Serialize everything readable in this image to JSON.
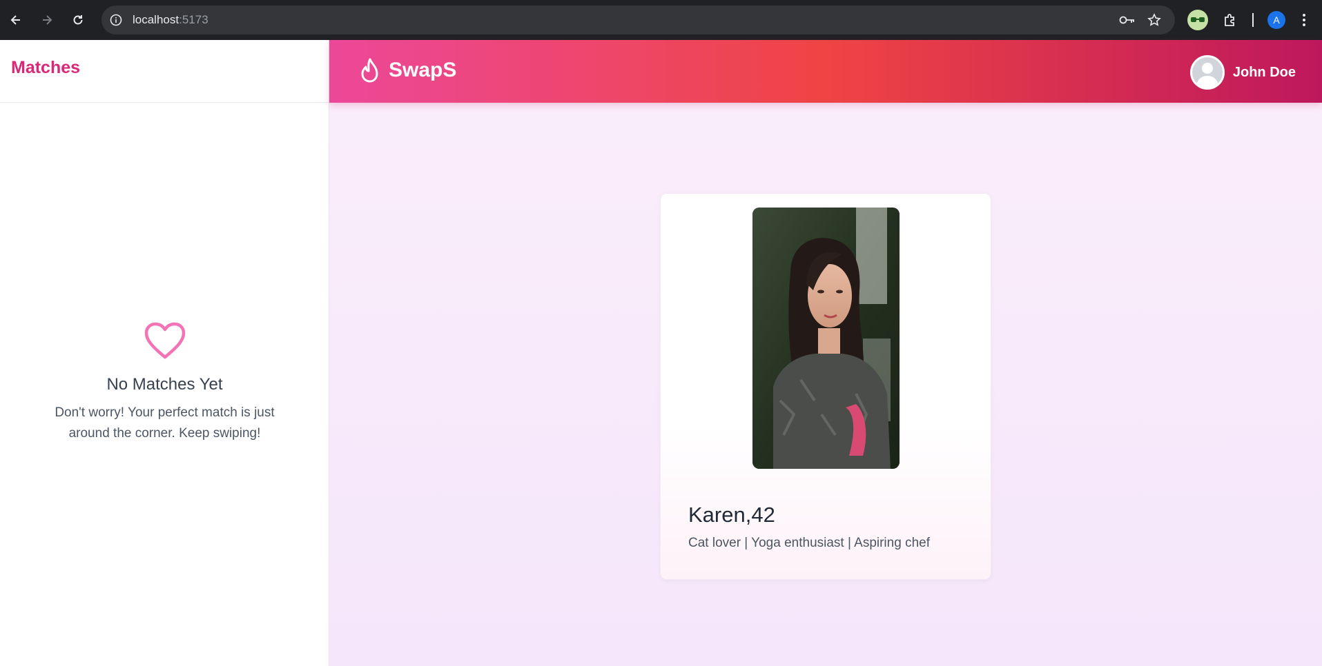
{
  "browser": {
    "url_host": "localhost",
    "url_port": ":5173",
    "profile_initial": "A"
  },
  "sidebar": {
    "title": "Matches",
    "empty_state": {
      "icon": "heart-icon",
      "heading": "No Matches Yet",
      "message": "Don't worry! Your perfect match is just around the corner. Keep swiping!"
    }
  },
  "header": {
    "brand": "SwapS",
    "brand_icon": "flame-icon",
    "user_name": "John Doe"
  },
  "card": {
    "name_age": "Karen,42",
    "bio": "Cat lover | Yoga enthusiast | Aspiring chef"
  },
  "colors": {
    "brand_pink": "#db2777",
    "gradient_start": "#ec4899",
    "gradient_mid": "#ef4444",
    "gradient_end": "#be185d",
    "heart": "#f472b6"
  }
}
